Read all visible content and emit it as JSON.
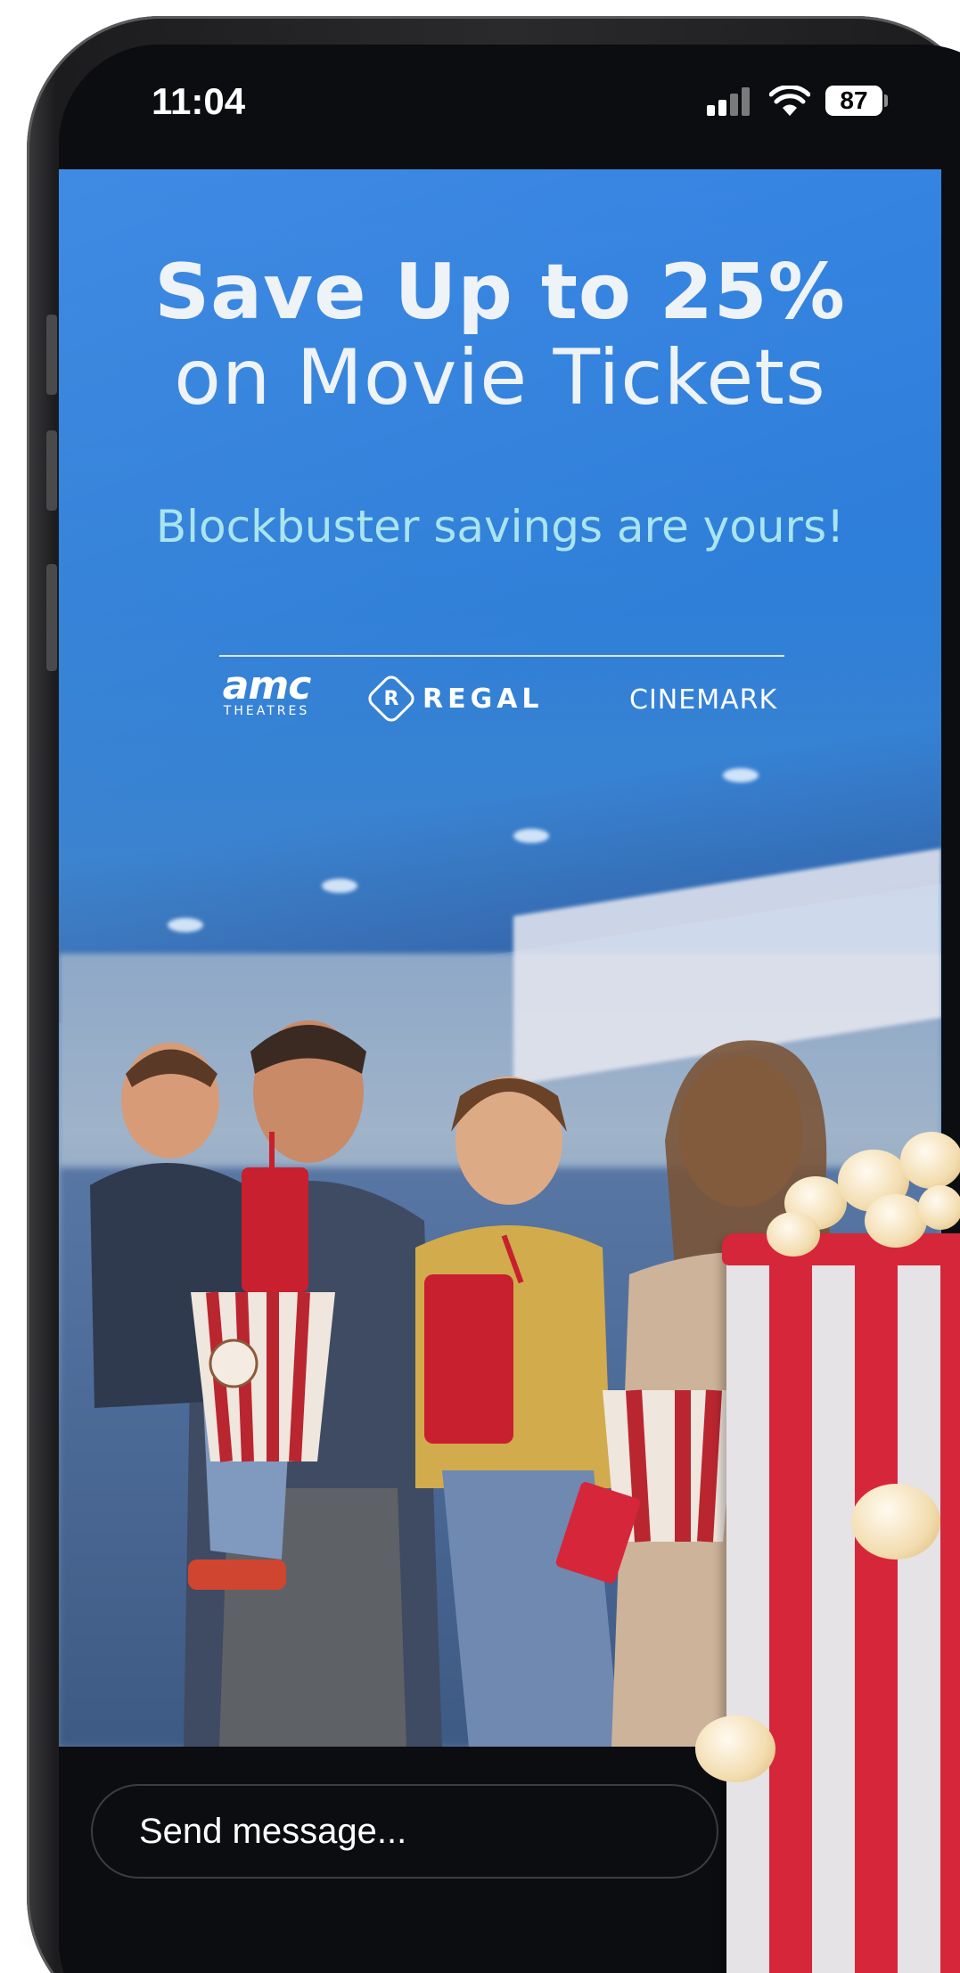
{
  "status_bar": {
    "time": "11:04",
    "battery": "87",
    "icons": [
      "cellular-signal-icon",
      "wifi-icon",
      "battery-icon"
    ]
  },
  "promo": {
    "headline_line1": "Save Up to 25%",
    "headline_line2": "on Movie Tickets",
    "subheadline": "Blockbuster savings are yours!",
    "brands": {
      "amc_main": "amc",
      "amc_sub": "THEATRES",
      "regal_mark": "R",
      "regal": "REGAL",
      "cinemark": "CINEMARK"
    },
    "image_description_icon": "family-at-cinema-image"
  },
  "composer": {
    "placeholder": "Send message..."
  },
  "colors": {
    "hero_blue": "#2a7de0",
    "subheadline_cyan": "#a9e4ef",
    "popcorn_red": "#d6263a",
    "background_dark": "#0b0d10"
  }
}
